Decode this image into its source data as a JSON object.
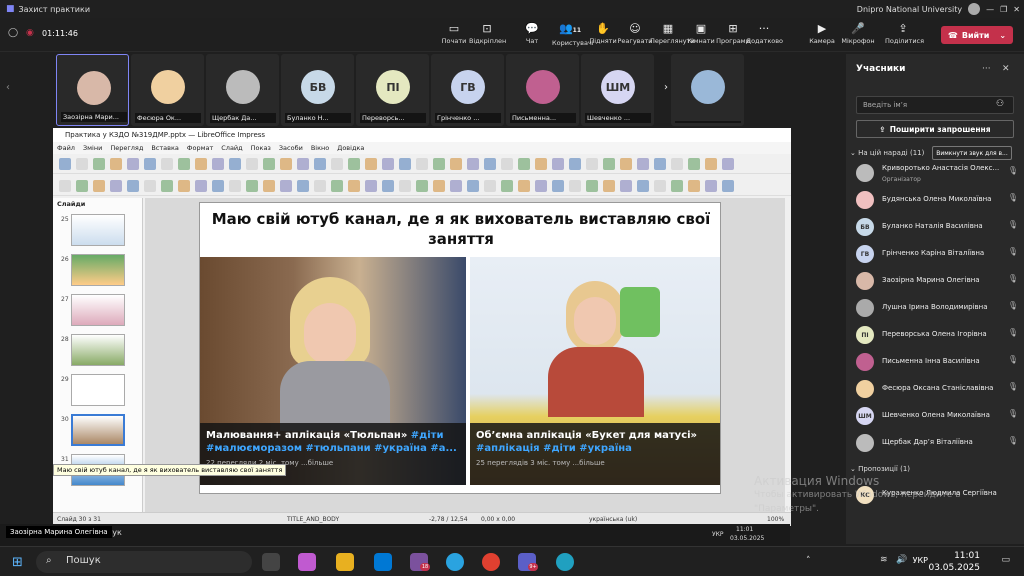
{
  "teams": {
    "window_title": "Захист практики",
    "org": "Dnipro National University",
    "timer": "01:11:46",
    "toolbar": [
      {
        "label": "Почати",
        "icon": "screen-icon"
      },
      {
        "label": "Відкріплен",
        "icon": "unpin-icon"
      },
      {
        "label": "Чат",
        "icon": "chat-icon"
      },
      {
        "label": "Користувачі",
        "icon": "people-icon",
        "count": "11"
      },
      {
        "label": "Підняти",
        "icon": "hand-icon"
      },
      {
        "label": "Реагувати",
        "icon": "emoji-icon"
      },
      {
        "label": "Переглянути",
        "icon": "view-icon"
      },
      {
        "label": "Кімнати",
        "icon": "rooms-icon"
      },
      {
        "label": "Програми",
        "icon": "apps-icon"
      },
      {
        "label": "Додатково",
        "icon": "more-icon"
      },
      {
        "label": "Камера",
        "icon": "camera-icon"
      },
      {
        "label": "Мікрофон",
        "icon": "mic-icon"
      },
      {
        "label": "Поділитися",
        "icon": "share-icon"
      }
    ],
    "leave_label": "Вийти"
  },
  "strip": [
    {
      "name": "Заозірна Мари...",
      "initials": "",
      "color": "#d8b8a8"
    },
    {
      "name": "Фесюра Ок...",
      "initials": "",
      "color": "#f0d0a0"
    },
    {
      "name": "Щербак Да...",
      "initials": "",
      "color": "#bbbbbb"
    },
    {
      "name": "Буланко Н...",
      "initials": "БВ",
      "color": "#c7d9e8"
    },
    {
      "name": "Переворсь...",
      "initials": "ПІ",
      "color": "#e4e8c0"
    },
    {
      "name": "Грінченко ...",
      "initials": "ГВ",
      "color": "#c7d3ee"
    },
    {
      "name": "Письменна...",
      "initials": "",
      "color": "#c06090"
    },
    {
      "name": "Шевченко ...",
      "initials": "ШМ",
      "color": "#d6d6f2"
    },
    {
      "name": "",
      "initials": "",
      "color": "#9ab8d8"
    }
  ],
  "panel": {
    "title": "Учасники",
    "search_placeholder": "Введіть ім’я",
    "invite_label": "Поширити запрошення",
    "in_meeting": "На цій нараді (11)",
    "mute_all": "Вимкнути звук для в...",
    "participants": [
      {
        "name": "Криворотько Анастасія Олекс...",
        "role": "Організатор",
        "initials": "",
        "color": "#bbbbbb"
      },
      {
        "name": "Будянська Олена Миколаївна",
        "role": "",
        "initials": "",
        "color": "#f0c0c0"
      },
      {
        "name": "Буланко Наталія Василівна",
        "role": "",
        "initials": "БВ",
        "color": "#c7d9e8"
      },
      {
        "name": "Грінченко Каріна Віталіївна",
        "role": "",
        "initials": "ГВ",
        "color": "#c7d3ee"
      },
      {
        "name": "Заозірна Марина Олегівна",
        "role": "",
        "initials": "",
        "color": "#d8b8a8"
      },
      {
        "name": "Лушна Ірина Володимирівна",
        "role": "",
        "initials": "",
        "color": "#aaaaaa"
      },
      {
        "name": "Переворська Олена Ігорівна",
        "role": "",
        "initials": "ПІ",
        "color": "#e4e8c0"
      },
      {
        "name": "Письменна Інна Василівна",
        "role": "",
        "initials": "",
        "color": "#c06090"
      },
      {
        "name": "Фесюра Оксана Станіславівна",
        "role": "",
        "initials": "",
        "color": "#f0d0a0"
      },
      {
        "name": "Шевченко Олена Миколаївна",
        "role": "",
        "initials": "ШМ",
        "color": "#d6d6f2"
      },
      {
        "name": "Щербак Дар’я Віталіївна",
        "role": "",
        "initials": "",
        "color": "#bbbbbb"
      }
    ],
    "suggestions": "Пропозиції (1)",
    "suggested": {
      "name": "Кураженко Людмила Сергіївна",
      "initials": "КС",
      "color": "#f1e0c0"
    }
  },
  "impress": {
    "window_title": "Практика у КЗДО №319ДМР.pptx — LibreOffice Impress",
    "menu": [
      "Файл",
      "Зміни",
      "Перегляд",
      "Вставка",
      "Формат",
      "Слайд",
      "Показ",
      "Засоби",
      "Вікно",
      "Довідка"
    ],
    "slides_header": "Слайди",
    "slide_numbers": [
      "25",
      "26",
      "27",
      "28",
      "29",
      "30",
      "31"
    ],
    "tooltip": "Маю свій ютуб канал, де я як вихователь виставляю свої заняття",
    "slide_title": "Маю свій ютуб канал, де я як вихователь виставляю свої заняття",
    "video1": {
      "title": "Малювання+ аплікація «Тюльпан»",
      "tags": "#діти #малюєморазом #тюльпани #україна #а...",
      "meta": "22 перегляди  2 міс. тому  ...більше"
    },
    "video2": {
      "title": "Об’ємна аплікація «Букет для матусі»",
      "tags": "#аплікація #діти #україна",
      "meta": "25 переглядів  3 міс. тому  ...більше"
    },
    "status": {
      "slide": "Слайд 30 з 31",
      "layout": "TITLE_AND_BODY",
      "pos": "-2,78 / 12,54",
      "size": "0,00 x 0,00",
      "lang": "українська (uk)",
      "zoom": "100%"
    },
    "inner_clock": {
      "time": "11:01",
      "date": "03.05.2025"
    },
    "inner_lang": "УКР",
    "inner_search": "Пошук"
  },
  "watermark": {
    "line1": "Активация Windows",
    "line2": "Чтобы активировать Windows, перейдите в",
    "line3": "\"Параметры\"."
  },
  "presenter": "Заозірна Марина Олегівна",
  "taskbar": {
    "search": "Пошук",
    "lang": "УКР",
    "time": "11:01",
    "date": "03.05.2025",
    "badge1": "18",
    "badge2": "9+"
  }
}
